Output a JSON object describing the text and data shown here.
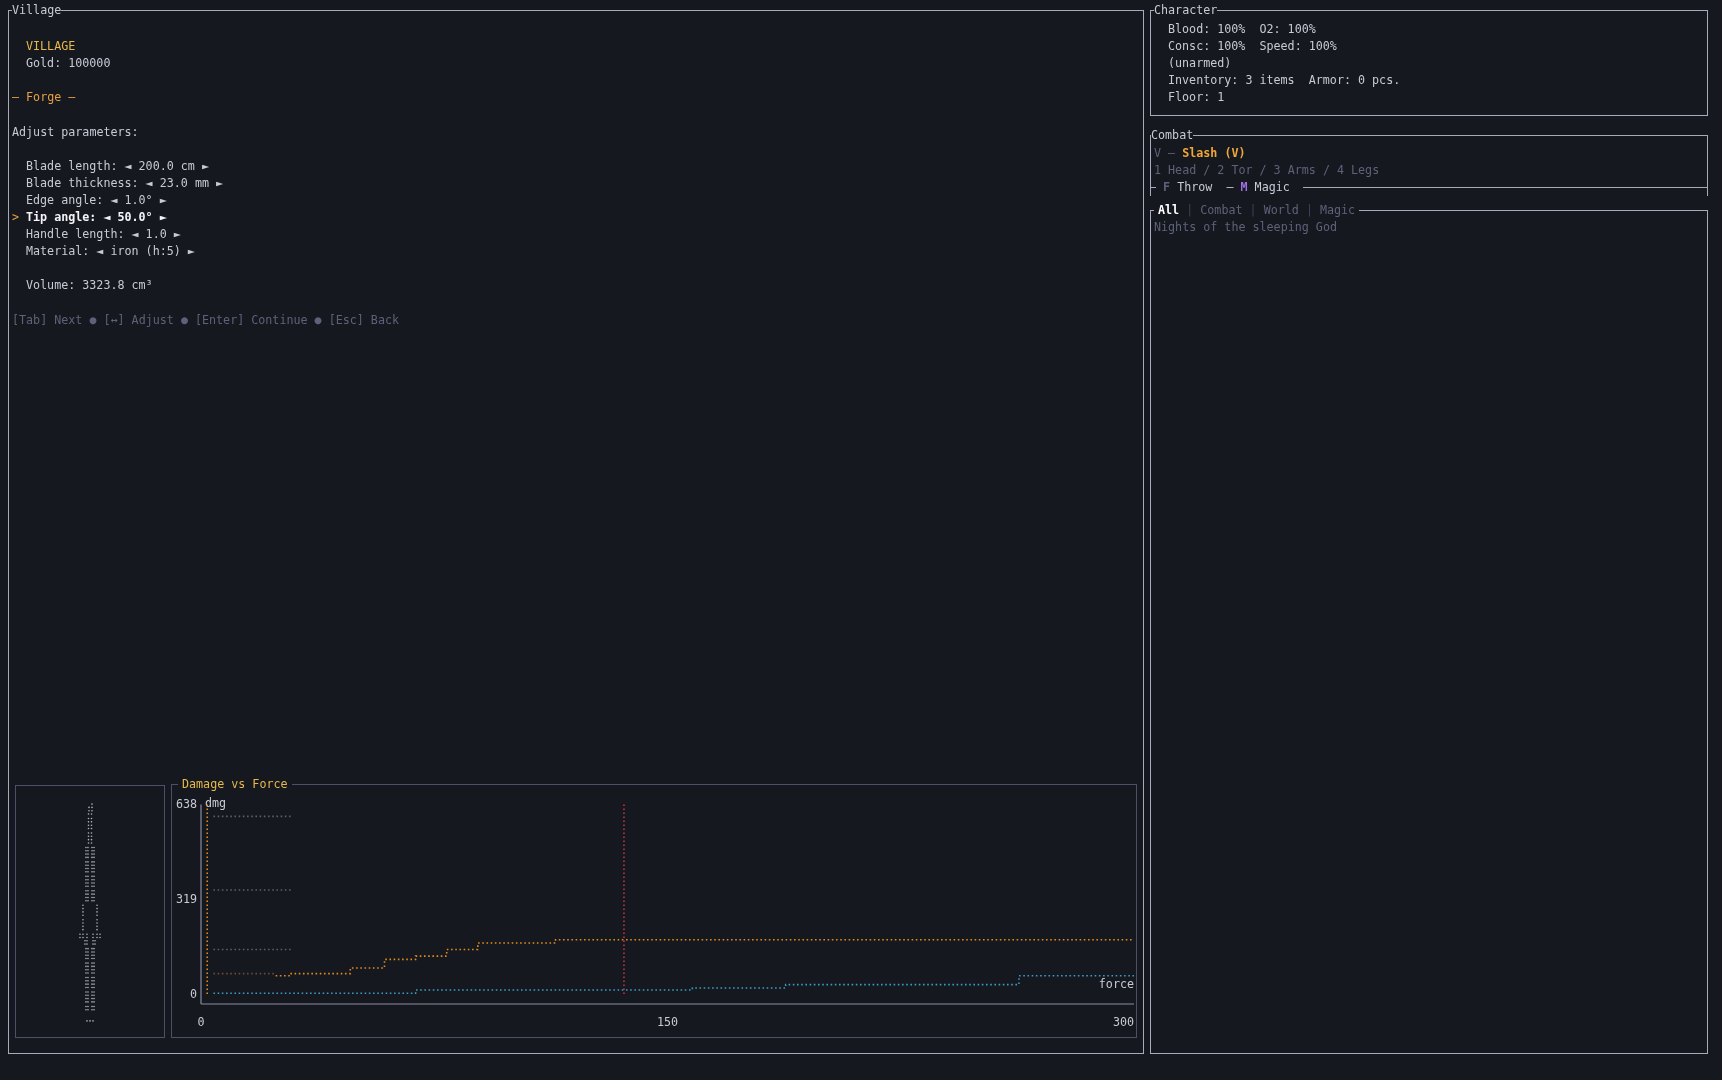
{
  "village": {
    "title": "Village",
    "header": "VILLAGE",
    "gold": "Gold: 100000",
    "section": "— Forge —",
    "prompt": "Adjust parameters:",
    "cursor": ">",
    "parameters": [
      {
        "text": "Blade length: ◄ 200.0 cm ►",
        "selected": false
      },
      {
        "text": "Blade thickness: ◄ 23.0 mm ►",
        "selected": false
      },
      {
        "text": "Edge angle: ◄ 1.0° ►",
        "selected": false
      },
      {
        "text": "Tip angle: ◄ 50.0° ►",
        "selected": true
      },
      {
        "text": "Handle length: ◄ 1.0 ►",
        "selected": false
      },
      {
        "text": "Material: ◄ iron (h:5) ►",
        "selected": false
      }
    ],
    "volume": "Volume: 3323.8 cm³",
    "help": "[Tab] Next ● [↔] Adjust ● [Enter] Continue ● [Esc] Back",
    "chart_panel": {
      "title": "Damage vs Force",
      "chart_data": {
        "type": "line",
        "ylabel": "dmg",
        "xlabel": "force",
        "xlim": [
          0,
          300
        ],
        "ylim": [
          0,
          638
        ],
        "xticks": [
          0,
          150,
          300
        ],
        "yticks": [
          0,
          319,
          638
        ],
        "x": [
          4,
          24,
          24,
          29,
          29,
          48,
          48,
          59,
          59,
          69,
          69,
          79,
          79,
          89,
          89,
          114,
          114,
          158,
          158,
          188,
          188,
          263,
          263,
          300
        ],
        "series": [
          {
            "color": "#5a5e72",
            "line_style": "dotted",
            "values": [
              598,
              598,
              598,
              598,
              null,
              null,
              null,
              null,
              null,
              null,
              null,
              null,
              null,
              null,
              null,
              null,
              null,
              null,
              null,
              null,
              null,
              null,
              null,
              null
            ]
          },
          {
            "color": "#5a5e72",
            "line_style": "dotted",
            "values": [
              351,
              351,
              351,
              351,
              null,
              null,
              null,
              null,
              null,
              null,
              null,
              null,
              null,
              null,
              null,
              null,
              null,
              null,
              null,
              null,
              null,
              null,
              null,
              null
            ]
          },
          {
            "color": "#5a5e72",
            "line_style": "dotted",
            "values": [
              151,
              151,
              151,
              151,
              null,
              null,
              null,
              null,
              null,
              null,
              null,
              null,
              null,
              null,
              null,
              null,
              null,
              null,
              null,
              null,
              null,
              null,
              null,
              null
            ]
          },
          {
            "color": "#6a4a3a",
            "line_style": "dotted",
            "values": [
              70,
              70,
              null,
              null,
              null,
              null,
              null,
              null,
              null,
              null,
              null,
              null,
              null,
              null,
              null,
              null,
              null,
              null,
              null,
              null,
              null,
              null,
              null,
              null
            ]
          },
          {
            "color": "#e08a20",
            "line_style": "dotted",
            "values": [
              null,
              null,
              63,
              63,
              70,
              70,
              89,
              89,
              118,
              118,
              129,
              129,
              151,
              151,
              173,
              173,
              184,
              184,
              184,
              184,
              184,
              184,
              184,
              184
            ]
          },
          {
            "color": "#3a9cc4",
            "line_style": "dotted",
            "values": [
              4,
              4,
              4,
              4,
              4,
              4,
              4,
              4,
              4,
              4,
              15,
              15,
              15,
              15,
              15,
              15,
              15,
              15,
              22,
              22,
              33,
              33,
              63,
              63
            ]
          }
        ],
        "ref_lines": [
          {
            "axis": "x",
            "value": 136,
            "color": "#c8323c"
          },
          {
            "axis": "x",
            "value": 2,
            "color": "#e08a20"
          }
        ]
      }
    }
  },
  "character": {
    "title": "Character",
    "lines": [
      "Blood: 100%  O2: 100%",
      "Consc: 100%  Speed: 100%",
      "(unarmed)",
      "Inventory: 3 items  Armor: 0 pcs.",
      "Floor: 1"
    ]
  },
  "combat": {
    "title": "Combat",
    "current": {
      "key": "V",
      "separator": "–",
      "label": "Slash (V)"
    },
    "targets": "1 Head / 2 Tor / 3 Arms / 4 Legs",
    "actions": [
      {
        "key": "F",
        "label": "Throw",
        "color": "#5e6279"
      },
      {
        "key": "M",
        "label": "Magic",
        "color": "#a070e8",
        "separator": "–"
      }
    ]
  },
  "log": {
    "tabs": [
      {
        "label": "All",
        "selected": true
      },
      {
        "label": "Combat",
        "selected": false,
        "separator": "|"
      },
      {
        "label": "World",
        "selected": false,
        "separator": "|"
      },
      {
        "label": "Magic",
        "selected": false,
        "separator": "|"
      }
    ],
    "messages": [
      "Nights of the sleeping God"
    ]
  }
}
